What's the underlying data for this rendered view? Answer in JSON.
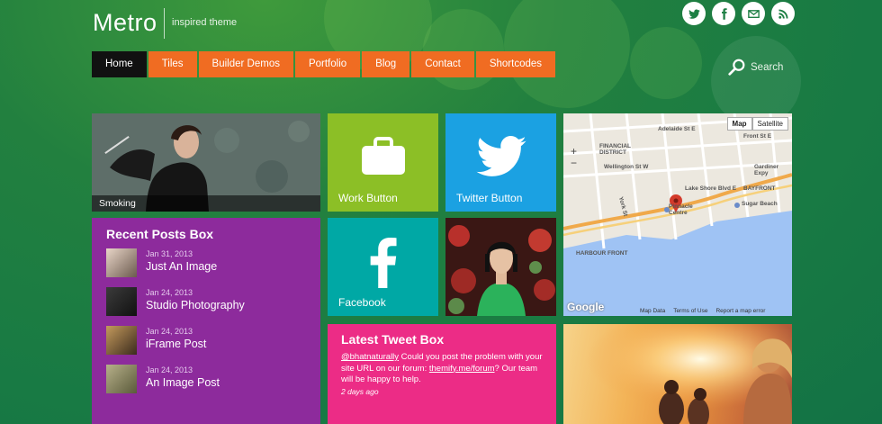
{
  "header": {
    "logo": "Metro",
    "tagline": "inspired theme",
    "social_icons": [
      "twitter-icon",
      "facebook-icon",
      "mail-icon",
      "rss-icon"
    ]
  },
  "nav": {
    "items": [
      "Home",
      "Tiles",
      "Builder Demos",
      "Portfolio",
      "Blog",
      "Contact",
      "Shortcodes"
    ],
    "active": "Home"
  },
  "search": {
    "label": "Search"
  },
  "tiles": {
    "smoking": {
      "caption": "Smoking"
    },
    "work": {
      "label": "Work Button",
      "icon": "briefcase-icon"
    },
    "twitter": {
      "label": "Twitter Button",
      "icon": "twitter-bird-icon"
    },
    "facebook": {
      "label": "Facebook",
      "icon": "facebook-f-icon"
    }
  },
  "recent_posts": {
    "title": "Recent Posts Box",
    "posts": [
      {
        "date": "Jan 31, 2013",
        "title": "Just An Image"
      },
      {
        "date": "Jan 24, 2013",
        "title": "Studio Photography"
      },
      {
        "date": "Jan 24, 2013",
        "title": "iFrame Post"
      },
      {
        "date": "Jan 24, 2013",
        "title": "An Image Post"
      }
    ]
  },
  "tweet_box": {
    "title": "Latest Tweet Box",
    "handle": "@bhatnaturally",
    "text_1": " Could you post the problem with your site URL on our forum: ",
    "link": "themify.me/forum",
    "text_2": "? Our team will be happy to help.",
    "time": "2 days ago"
  },
  "map": {
    "buttons": [
      "Map",
      "Satellite"
    ],
    "zoom_in": "+",
    "zoom_out": "−",
    "labels": [
      "FINANCIAL DISTRICT",
      "Wellington St W",
      "Adelaide St E",
      "Front St E",
      "Gardiner Expy",
      "Lake Shore Blvd E",
      "BAYFRONT",
      "Sugar Beach",
      "Pinnacle Centre",
      "HARBOUR FRONT",
      "York St"
    ],
    "footer": [
      "Map Data",
      "Terms of Use",
      "Report a map error"
    ],
    "logo": "Google"
  },
  "colors": {
    "nav_orange": "#f06c22",
    "purple": "#8d2b9c",
    "lime": "#8cbf26",
    "twitter_blue": "#1ba1e2",
    "teal": "#00a8a5",
    "pink": "#ec2c86"
  }
}
